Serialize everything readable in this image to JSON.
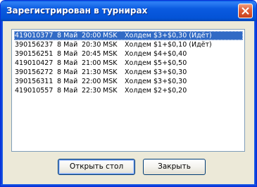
{
  "window": {
    "title": "Зарегистрирован в турнирах"
  },
  "tournaments": [
    {
      "id": "419010377",
      "date": "8 Май",
      "time": "20:00",
      "tz": "MSK",
      "desc": "Холдем $3+$0,30  (Идёт)",
      "selected": true
    },
    {
      "id": "390156237",
      "date": "8 Май",
      "time": "20:30",
      "tz": "MSK",
      "desc": "Холдем $1+$0,10  (Идёт)",
      "selected": false
    },
    {
      "id": "390156251",
      "date": "8 Май",
      "time": "20:45",
      "tz": "MSK",
      "desc": "Холдем $4+$0,40",
      "selected": false
    },
    {
      "id": "419010427",
      "date": "8 Май",
      "time": "21:00",
      "tz": "MSK",
      "desc": "Холдем $5+$0,50",
      "selected": false
    },
    {
      "id": "390156272",
      "date": "8 Май",
      "time": "21:30",
      "tz": "MSK",
      "desc": "Холдем $3+$0,30",
      "selected": false
    },
    {
      "id": "390156311",
      "date": "8 Май",
      "time": "22:00",
      "tz": "MSK",
      "desc": "Холдем $3+$0,30",
      "selected": false
    },
    {
      "id": "419010557",
      "date": "8 Май",
      "time": "22:30",
      "tz": "MSK",
      "desc": "Холдем $2+$0,20",
      "selected": false
    }
  ],
  "buttons": {
    "open_table": "Открыть стол",
    "close": "Закрыть"
  },
  "colors": {
    "titlebar": "#0a5ae0",
    "selection": "#316ac5",
    "dialog_bg": "#ece9d8"
  }
}
